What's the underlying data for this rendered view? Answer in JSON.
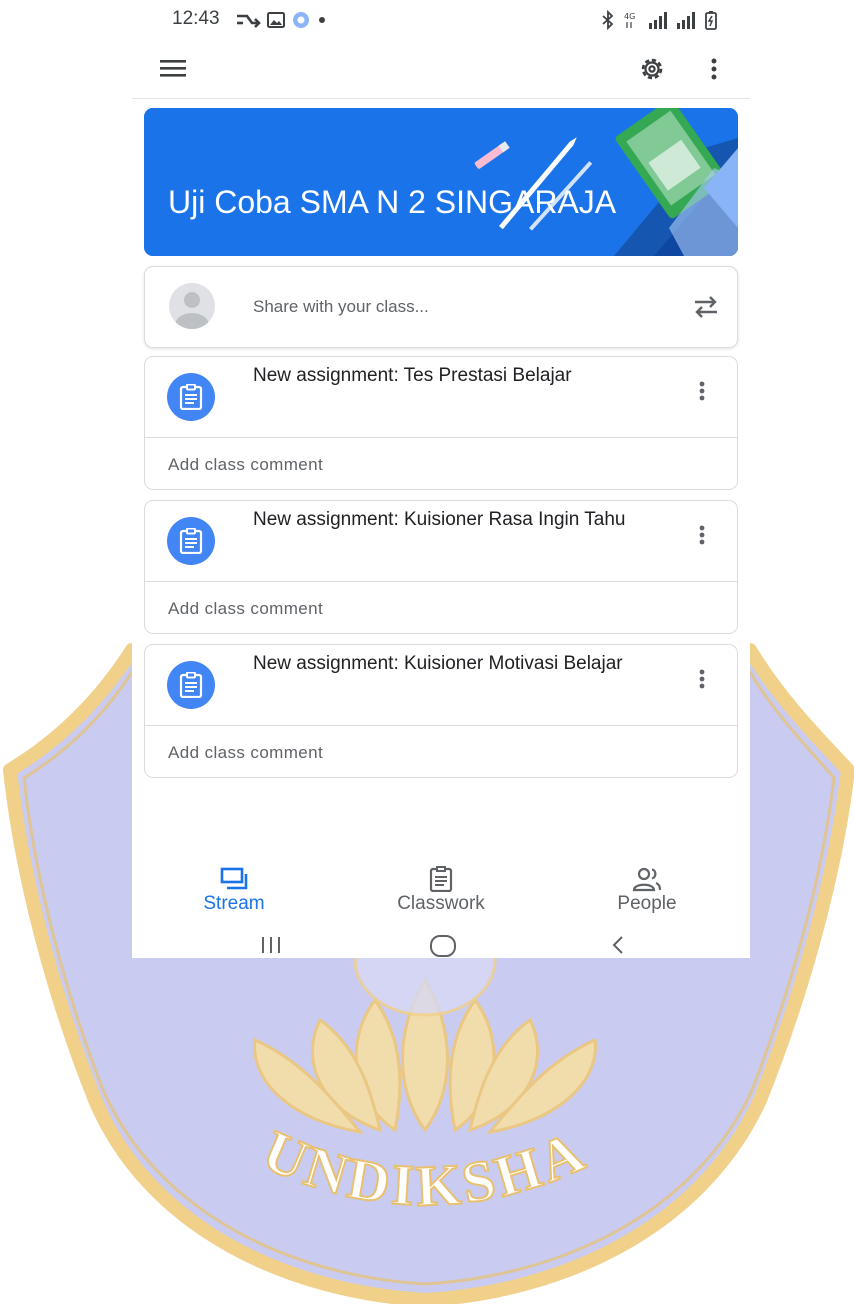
{
  "status_bar": {
    "time": "12:43"
  },
  "header": {
    "menu_icon": "menu-icon",
    "settings_icon": "gear-icon",
    "more_icon": "more-vert-icon"
  },
  "banner": {
    "title": "Uji Coba SMA N 2 SINGARAJA",
    "color": "#1a73e8"
  },
  "share": {
    "placeholder": "Share with your class..."
  },
  "posts": [
    {
      "title": "New assignment: Tes Prestasi Belajar",
      "comment_placeholder": "Add class comment"
    },
    {
      "title": "New assignment: Kuisioner Rasa Ingin Tahu",
      "comment_placeholder": "Add class comment"
    },
    {
      "title": "New assignment: Kuisioner Motivasi Belajar",
      "comment_placeholder": "Add class comment"
    }
  ],
  "bottom_nav": {
    "items": [
      {
        "label": "Stream",
        "icon": "stream-icon",
        "active": true
      },
      {
        "label": "Classwork",
        "icon": "classwork-icon",
        "active": false
      },
      {
        "label": "People",
        "icon": "people-icon",
        "active": false
      }
    ]
  },
  "watermark": {
    "text": "UNDIKSHA"
  },
  "colors": {
    "accent": "#1a73e8",
    "assignment_icon": "#4285f4",
    "watermark_fill": "#c9cbf0",
    "watermark_gold": "#f1d08a"
  }
}
